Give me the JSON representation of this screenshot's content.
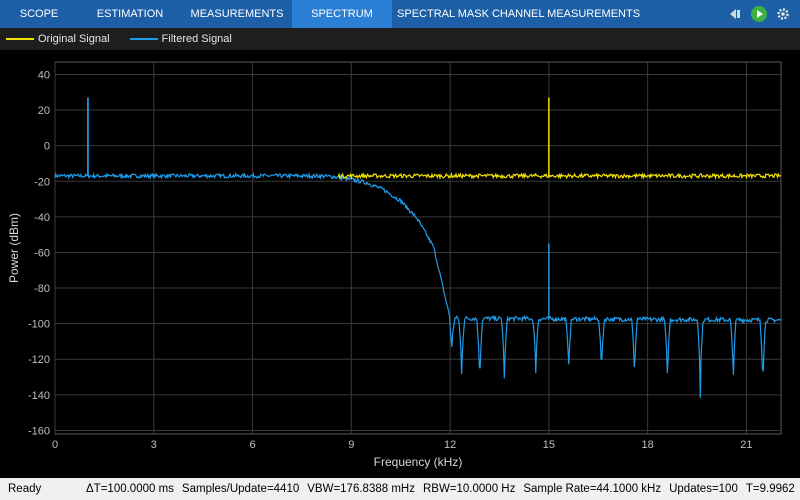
{
  "toolbar": {
    "tabs": [
      {
        "label": "SCOPE"
      },
      {
        "label": "ESTIMATION"
      },
      {
        "label": "MEASUREMENTS"
      },
      {
        "label": "SPECTRUM"
      },
      {
        "label": "SPECTRAL MASK"
      },
      {
        "label": "CHANNEL MEASUREMENTS"
      }
    ],
    "active_tab": "SPECTRUM",
    "icons": [
      "undock-icon",
      "run-icon",
      "settings-icon"
    ],
    "colors": {
      "bar": "#1d5fa6",
      "active": "#2b7fd4",
      "run": "#3cb043"
    }
  },
  "legend": {
    "items": [
      {
        "label": "Original Signal",
        "color": "#f2e200"
      },
      {
        "label": "Filtered Signal",
        "color": "#1f9be8"
      }
    ]
  },
  "chart_data": {
    "type": "line",
    "xlabel": "Frequency (kHz)",
    "ylabel": "Power (dBm)",
    "xlim": [
      0,
      22.05
    ],
    "ylim": [
      -162,
      47
    ],
    "xticks": [
      0,
      3,
      6,
      9,
      12,
      15,
      18,
      21
    ],
    "yticks": [
      40,
      20,
      0,
      -20,
      -40,
      -60,
      -80,
      -100,
      -120,
      -140,
      -160
    ],
    "grid": true,
    "legend_position": "top-left",
    "background": "#000000",
    "series": [
      {
        "name": "Original Signal",
        "color": "#f2e200",
        "noise_floor": -17,
        "points": [
          [
            0,
            -17
          ],
          [
            22.05,
            -17
          ]
        ],
        "spikes": [
          [
            1,
            27
          ],
          [
            15,
            27
          ]
        ]
      },
      {
        "name": "Filtered Signal",
        "color": "#1f9be8",
        "points": [
          [
            0,
            -17
          ],
          [
            8,
            -17
          ],
          [
            8.5,
            -17.5
          ],
          [
            9,
            -19
          ],
          [
            9.5,
            -21
          ],
          [
            10,
            -25
          ],
          [
            10.5,
            -31
          ],
          [
            11,
            -41
          ],
          [
            11.5,
            -57
          ],
          [
            12,
            -97
          ],
          [
            22.05,
            -98
          ]
        ],
        "spikes": [
          [
            1,
            27
          ],
          [
            15,
            -55
          ]
        ],
        "nulls": [
          [
            12.05,
            -118
          ],
          [
            12.35,
            -134
          ],
          [
            12.9,
            -140
          ],
          [
            13.65,
            -138
          ],
          [
            14.6,
            -132
          ],
          [
            15.6,
            -131
          ],
          [
            16.6,
            -134
          ],
          [
            17.6,
            -136
          ],
          [
            18.6,
            -138
          ],
          [
            19.6,
            -142
          ],
          [
            20.6,
            -138
          ],
          [
            21.5,
            -141
          ]
        ],
        "stopband_level": -97
      }
    ]
  },
  "statusbar": {
    "ready": "Ready",
    "items": [
      "ΔT=100.0000 ms",
      "Samples/Update=4410",
      "VBW=176.8388 mHz",
      "RBW=10.0000 Hz",
      "Sample Rate=44.1000 kHz",
      "Updates=100",
      "T=9.9962"
    ]
  }
}
